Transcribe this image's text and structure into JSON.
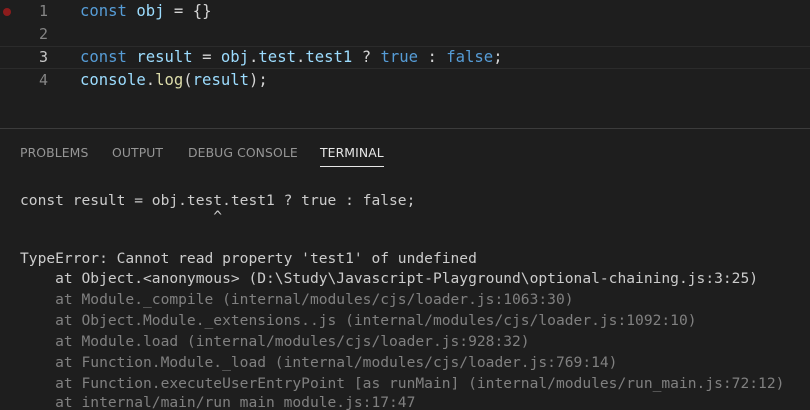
{
  "editor": {
    "lines": [
      {
        "number": "1",
        "tokens": [
          "const",
          "obj",
          "=",
          "{}"
        ]
      },
      {
        "number": "2",
        "tokens": []
      },
      {
        "number": "3",
        "tokens": [
          "const",
          "result",
          "=",
          "obj",
          ".",
          "test",
          ".",
          "test1",
          "?",
          "true",
          ":",
          "false",
          ";"
        ]
      },
      {
        "number": "4",
        "tokens": [
          "console",
          ".",
          "log",
          "(",
          "result",
          ");"
        ]
      }
    ]
  },
  "panel": {
    "tabs": [
      "PROBLEMS",
      "OUTPUT",
      "DEBUG CONSOLE",
      "TERMINAL"
    ],
    "active_tab": "TERMINAL"
  },
  "terminal": {
    "lines": [
      "const result = obj.test.test1 ? true : false;",
      "                      ^",
      "",
      "TypeError: Cannot read property 'test1' of undefined",
      "    at Object.<anonymous> (D:\\Study\\Javascript-Playground\\optional-chaining.js:3:25)",
      "    at Module._compile (internal/modules/cjs/loader.js:1063:30)",
      "    at Object.Module._extensions..js (internal/modules/cjs/loader.js:1092:10)",
      "    at Module.load (internal/modules/cjs/loader.js:928:32)",
      "    at Function.Module._load (internal/modules/cjs/loader.js:769:14)",
      "    at Function.executeUserEntryPoint [as runMain] (internal/modules/run_main.js:72:12)",
      "    at internal/main/run_main_module.js:17:47"
    ]
  },
  "colors": {
    "background": "#1e1e1e",
    "keyword": "#569cd6",
    "variable": "#9cdcfe",
    "function": "#dcdcaa",
    "breakpoint": "#8c1c1c",
    "stack_dim": "#808080"
  }
}
